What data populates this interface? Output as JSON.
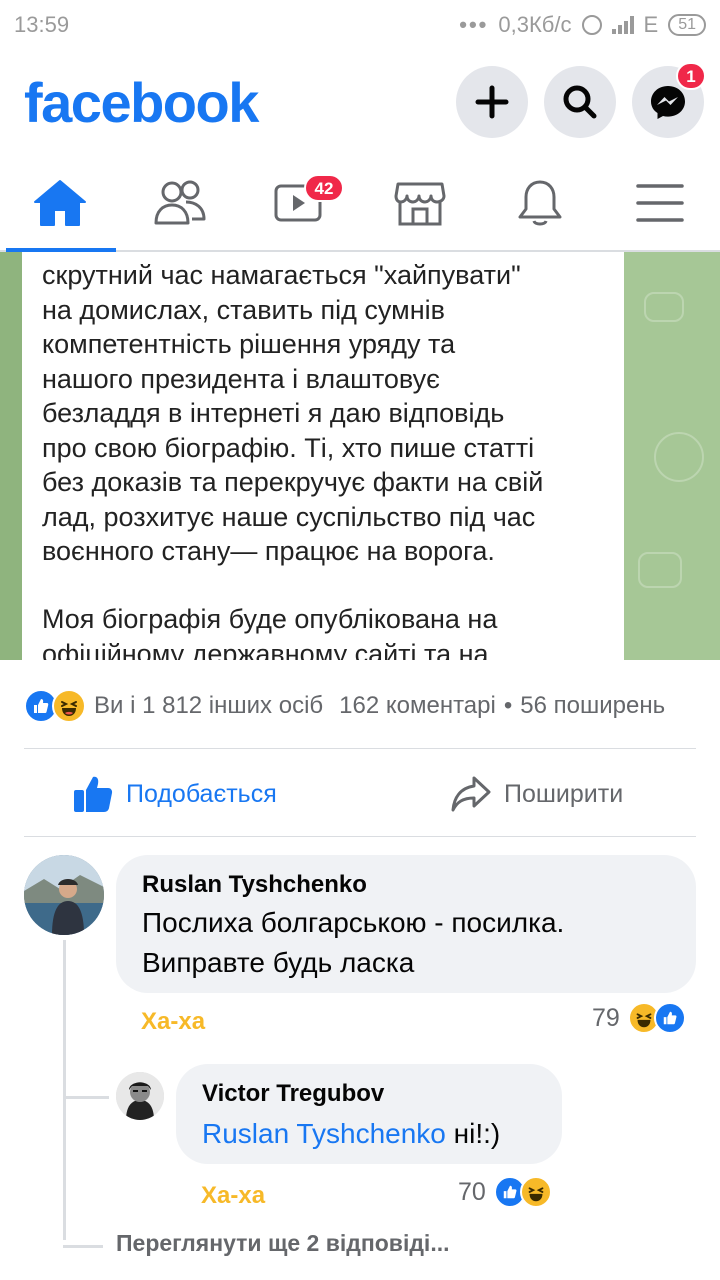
{
  "status_bar": {
    "time": "13:59",
    "net_speed": "0,3Кб/с",
    "network": "E",
    "battery": "51"
  },
  "header": {
    "logo": "facebook",
    "messenger_badge": "1",
    "icons": [
      "plus-icon",
      "search-icon",
      "messenger-icon"
    ]
  },
  "tabs": [
    {
      "name": "home",
      "icon": "home-icon",
      "active": true
    },
    {
      "name": "friends",
      "icon": "friends-icon"
    },
    {
      "name": "watch",
      "icon": "video-icon",
      "badge": "42"
    },
    {
      "name": "marketplace",
      "icon": "shop-icon"
    },
    {
      "name": "notifications",
      "icon": "bell-icon"
    },
    {
      "name": "menu",
      "icon": "menu-icon"
    }
  ],
  "post": {
    "text_lines_top": [
      "скрутний час намагається \"хайпувати\"",
      "на домислах, ставить під сумнів",
      "компетентність рішення уряду та",
      "нашого президента і влаштовує",
      "безладдя в інтернеті я даю відповідь",
      "про свою біографію. Ті, хто пише статті",
      "без доказів та перекручує факти на свій",
      "лад, розхитує наше суспільство під час",
      "воєнного стану— працює на ворога."
    ],
    "text_line_bottom": "Моя біографія буде опублікована на",
    "text_line_cut": "офіційному державному сайті та на"
  },
  "reactions": {
    "summary": "Ви і 1 812 інших осіб",
    "comments": "162 коментарі",
    "separator": "•",
    "shares": "56 поширень"
  },
  "actions": {
    "like_label": "Подобається",
    "share_label": "Поширити"
  },
  "comments": [
    {
      "author": "Ruslan Tyshchenko",
      "text_line1": "Послиха болгарською - посилка.",
      "text_line2": "Виправте будь ласка",
      "reaction_label": "Ха-ха",
      "reaction_count": "79"
    },
    {
      "author": "Victor Tregubov",
      "mention": "Ruslan Tyshchenko",
      "text": " ні!:)",
      "reaction_label": "Ха-ха",
      "reaction_count": "70"
    }
  ],
  "more_replies": "Переглянути ще 2 відповіді...",
  "colors": {
    "brand": "#1877f2",
    "haha": "#f7b928",
    "badge": "#f02849",
    "muted": "#65676b"
  }
}
